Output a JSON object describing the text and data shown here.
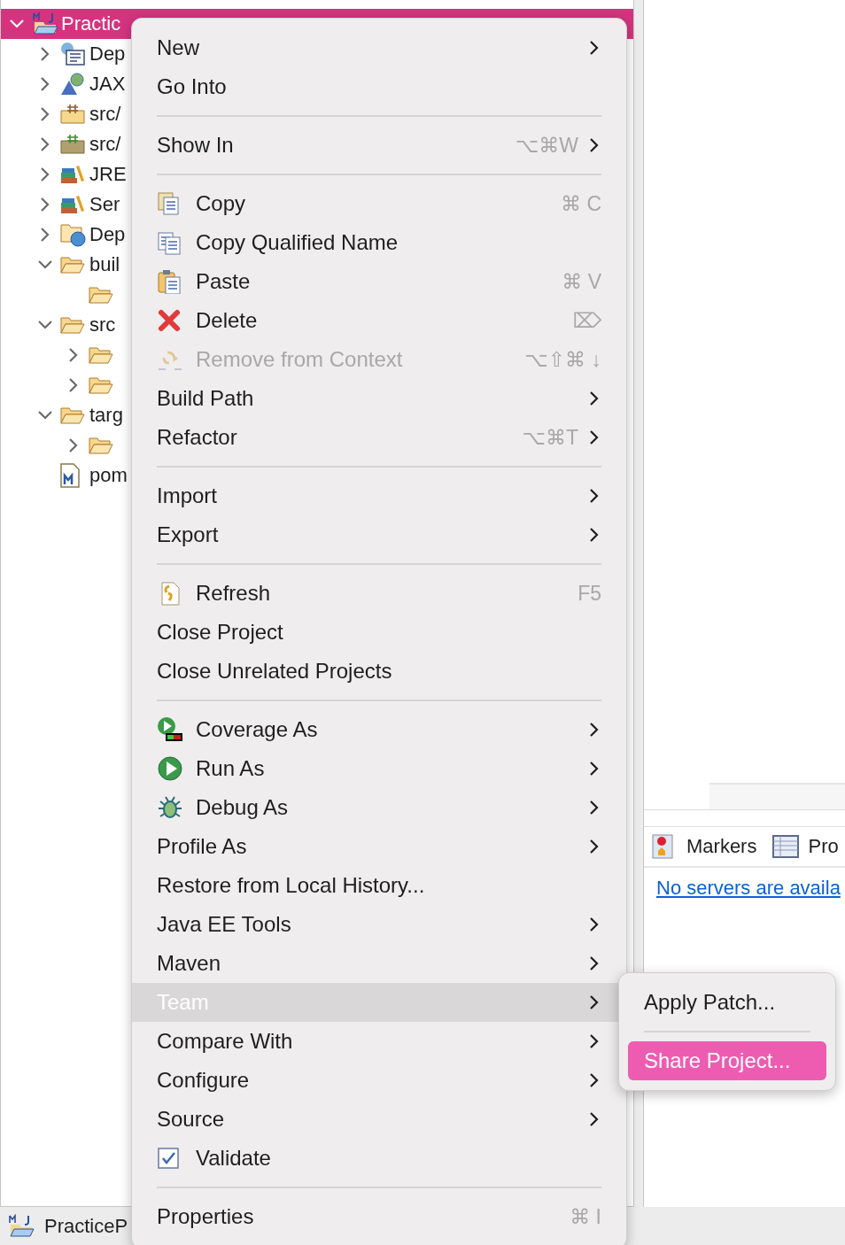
{
  "tree": [
    {
      "label": "Practic",
      "expanded": true,
      "selected": true,
      "children": [
        {
          "label": "Dep",
          "expanded": false,
          "selected": false
        },
        {
          "label": "JAX",
          "expanded": false,
          "selected": false
        },
        {
          "label": "src/",
          "expanded": false,
          "selected": false
        },
        {
          "label": "src/",
          "expanded": false,
          "selected": false
        },
        {
          "label": "JRE",
          "expanded": false,
          "selected": false
        },
        {
          "label": "Ser",
          "expanded": false,
          "selected": false
        },
        {
          "label": "Dep",
          "expanded": false,
          "selected": false
        },
        {
          "label": "buil",
          "expanded": true,
          "selected": false,
          "children": [
            {
              "selected": false
            }
          ]
        },
        {
          "label": "src",
          "expanded": true,
          "selected": false,
          "children": [
            {
              "expanded": false,
              "selected": false
            },
            {
              "expanded": false,
              "selected": false
            }
          ]
        },
        {
          "label": "targ",
          "expanded": true,
          "selected": false,
          "children": [
            {
              "expanded": false,
              "selected": false
            }
          ]
        },
        {
          "label": "pom",
          "selected": false
        }
      ]
    }
  ],
  "views": {
    "tabs": [
      {
        "label": "Markers"
      },
      {
        "label": "Pro"
      }
    ],
    "link": "No servers are availa"
  },
  "status_bar": {
    "label": "PracticeP"
  },
  "context_menu": {
    "groups": [
      [
        {
          "label": "New",
          "submenu": true,
          "selected": false
        },
        {
          "label": "Go Into",
          "submenu": false,
          "selected": false
        }
      ],
      [
        {
          "label": "Show In",
          "shortcut": "⌥⌘W",
          "submenu": true,
          "selected": false
        }
      ],
      [
        {
          "label": "Copy",
          "shortcut": "⌘ C",
          "submenu": false,
          "selected": false
        },
        {
          "label": "Copy Qualified Name",
          "submenu": false,
          "selected": false
        },
        {
          "label": "Paste",
          "shortcut": "⌘ V",
          "submenu": false,
          "selected": false
        },
        {
          "label": "Delete",
          "shortcut": "⌦",
          "submenu": false,
          "selected": false
        },
        {
          "label": "Remove from Context",
          "shortcut": "⌥⇧⌘ ↓",
          "submenu": false,
          "disabled": true,
          "selected": false
        },
        {
          "label": "Build Path",
          "submenu": true,
          "selected": false
        },
        {
          "label": "Refactor",
          "shortcut": "⌥⌘T",
          "submenu": true,
          "selected": false
        }
      ],
      [
        {
          "label": "Import",
          "submenu": true,
          "selected": false
        },
        {
          "label": "Export",
          "submenu": true,
          "selected": false
        }
      ],
      [
        {
          "label": "Refresh",
          "shortcut": "F5",
          "submenu": false,
          "selected": false
        },
        {
          "label": "Close Project",
          "submenu": false,
          "selected": false
        },
        {
          "label": "Close Unrelated Projects",
          "submenu": false,
          "selected": false
        }
      ],
      [
        {
          "label": "Coverage As",
          "submenu": true,
          "selected": false
        },
        {
          "label": "Run As",
          "submenu": true,
          "selected": false
        },
        {
          "label": "Debug As",
          "submenu": true,
          "selected": false
        },
        {
          "label": "Profile As",
          "submenu": true,
          "selected": false
        },
        {
          "label": "Restore from Local History...",
          "submenu": false,
          "selected": false
        },
        {
          "label": "Java EE Tools",
          "submenu": true,
          "selected": false
        },
        {
          "label": "Maven",
          "submenu": true,
          "selected": false
        },
        {
          "label": "Team",
          "submenu": true,
          "selected": true
        },
        {
          "label": "Compare With",
          "submenu": true,
          "selected": false
        },
        {
          "label": "Configure",
          "submenu": true,
          "selected": false
        },
        {
          "label": "Source",
          "submenu": true,
          "selected": false
        },
        {
          "label": "Validate",
          "submenu": false,
          "selected": false
        }
      ],
      [
        {
          "label": "Properties",
          "shortcut": "⌘ I",
          "submenu": false,
          "selected": false
        }
      ]
    ]
  },
  "submenu": {
    "groups": [
      [
        {
          "label": "Apply Patch...",
          "selected": false
        }
      ],
      [
        {
          "label": "Share Project...",
          "selected": true
        }
      ]
    ]
  }
}
